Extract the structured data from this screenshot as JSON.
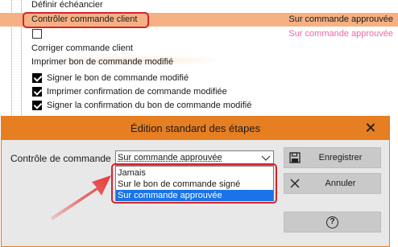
{
  "list": {
    "rows": [
      {
        "label": "Définir échéancier",
        "status": ""
      },
      {
        "label": "Contrôler commande client",
        "status": "Sur commande approuvée"
      },
      {
        "label": "",
        "status": "Sur commande approuvée"
      },
      {
        "label": "Corriger commande client",
        "status": ""
      },
      {
        "label": "Imprimer bon de commande modifié",
        "status": ""
      },
      {
        "label": "Signer le bon de commande modifié",
        "status": ""
      },
      {
        "label": "Imprimer confirmation de commande modifiée",
        "status": ""
      },
      {
        "label": "Signer la confirmation du bon de commande modifié",
        "status": ""
      }
    ]
  },
  "dialog": {
    "title": "Édition standard des étapes",
    "field_label": "Contrôle de commande",
    "select_value": "Sur commande approuvée",
    "options": [
      "Jamais",
      "Sur le bon de commande signé",
      "Sur commande approuvée"
    ],
    "save_label": "Enregistrer",
    "cancel_label": "Annuler",
    "help_glyph": "?"
  },
  "colors": {
    "accent": "#e67e22",
    "selected_row": "#f5b184",
    "highlight": "#d4242e",
    "option_selected": "#1a73e8",
    "pink_text": "#e76aa6"
  }
}
